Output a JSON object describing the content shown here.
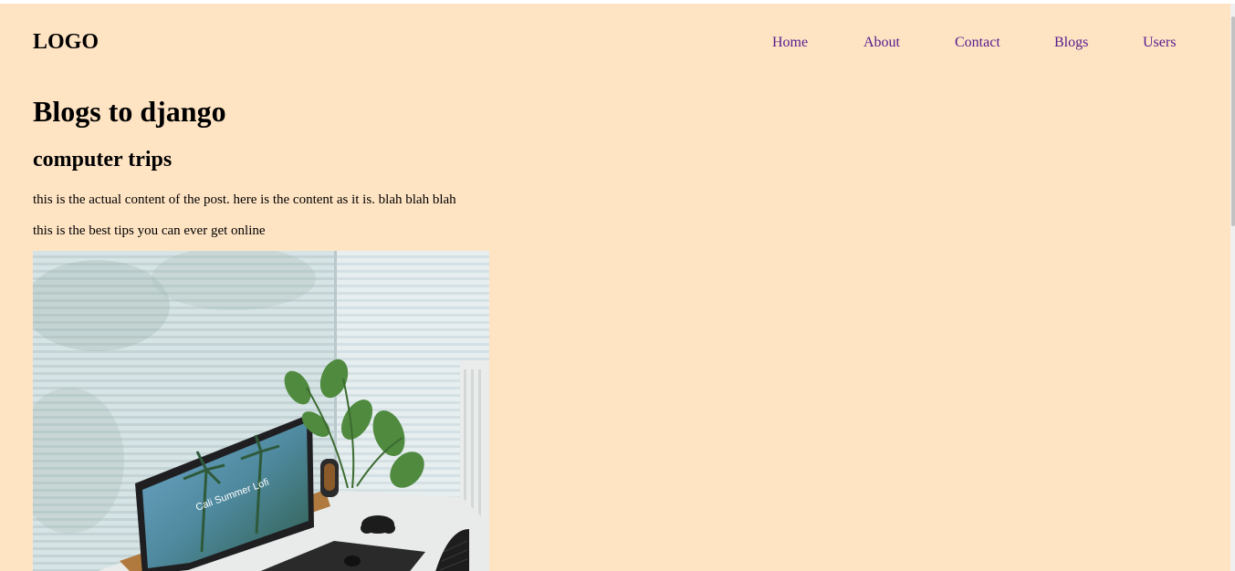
{
  "header": {
    "logo": "LOGO",
    "nav": {
      "home": "Home",
      "about": "About",
      "contact": "Contact",
      "blogs": "Blogs",
      "users": "Users"
    }
  },
  "main": {
    "page_title": "Blogs to django",
    "post": {
      "title": "computer trips",
      "content": "this is the actual content of the post. here is the content as it is. blah blah blah",
      "tagline": "this is the best tips you can ever get online",
      "image_monitor_text": "Cali Summer Lofi"
    }
  },
  "colors": {
    "background": "#ffe4c4",
    "link": "#551a8b",
    "text": "#000000"
  }
}
